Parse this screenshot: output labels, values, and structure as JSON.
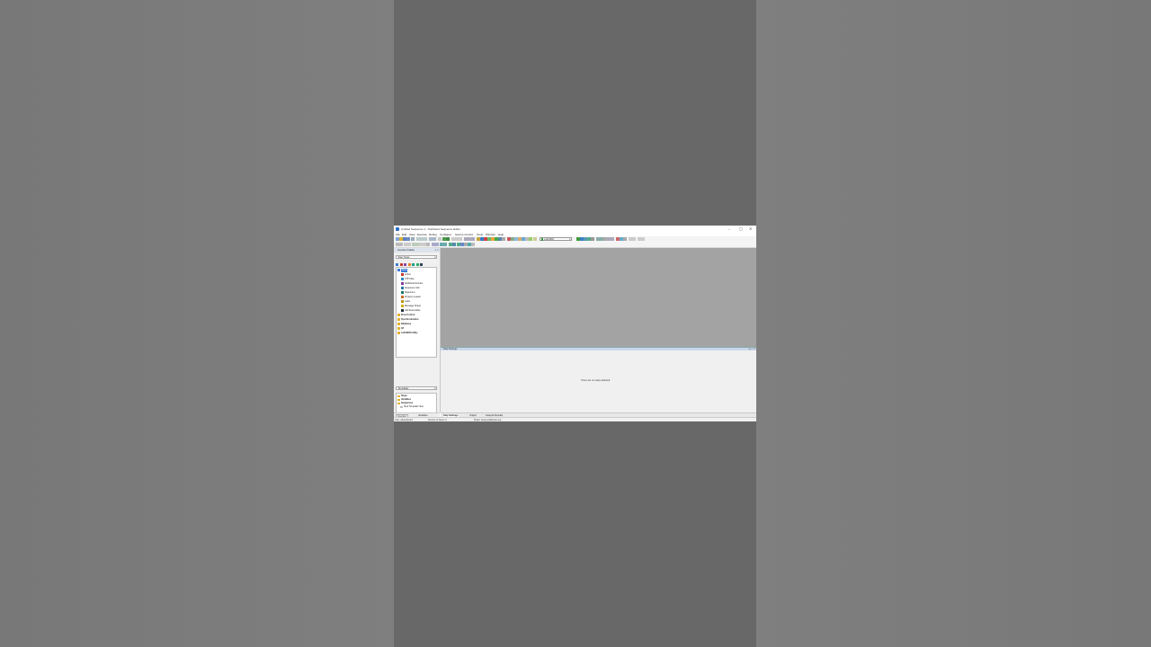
{
  "window": {
    "title": "Untitled Sequence 1 - TestStand Sequence Editor",
    "controls": [
      "–",
      "▢",
      "✕"
    ]
  },
  "menu": [
    "File",
    "Edit",
    "View",
    "Execute",
    "Debug",
    "Configure",
    "Source Control",
    "Tools",
    "Window",
    "Help"
  ],
  "toolbar": {
    "adapter_label": "LabVIEW"
  },
  "insertion_palette": {
    "title": "Insertion Palette",
    "step_types_label": "Step Types",
    "tree": [
      {
        "label": "Tests",
        "indent": 0,
        "bold": false,
        "selected": true,
        "color": "#3a7bd5"
      },
      {
        "label": "Action",
        "indent": 1,
        "bold": false,
        "selected": false,
        "color": "#c0392b"
      },
      {
        "label": "FTP Files",
        "indent": 1,
        "bold": false,
        "selected": false,
        "color": "#2e86c1"
      },
      {
        "label": "Additional Results",
        "indent": 1,
        "bold": false,
        "selected": false,
        "color": "#7d3c98"
      },
      {
        "label": "Sequence Call",
        "indent": 1,
        "bold": false,
        "selected": false,
        "color": "#2874a6"
      },
      {
        "label": "Statement",
        "indent": 1,
        "bold": false,
        "selected": false,
        "color": "#117a65"
      },
      {
        "label": "Property Loader",
        "indent": 1,
        "bold": false,
        "selected": false,
        "color": "#ca6f1e"
      },
      {
        "label": "Label",
        "indent": 1,
        "bold": false,
        "selected": false,
        "color": "#b7950b"
      },
      {
        "label": "Message Popup",
        "indent": 1,
        "bold": false,
        "selected": false,
        "color": "#d4ac0d"
      },
      {
        "label": "Call Executable",
        "indent": 1,
        "bold": false,
        "selected": false,
        "color": "#1f2d3d"
      },
      {
        "label": "Flow Control",
        "indent": 0,
        "bold": true,
        "selected": false,
        "color": "#e0b030"
      },
      {
        "label": "Synchronization",
        "indent": 0,
        "bold": true,
        "selected": false,
        "color": "#e0b030"
      },
      {
        "label": "Database",
        "indent": 0,
        "bold": true,
        "selected": false,
        "color": "#e0b030"
      },
      {
        "label": "IVI",
        "indent": 0,
        "bold": true,
        "selected": false,
        "color": "#e0b030"
      },
      {
        "label": "LabVIEW Utility",
        "indent": 0,
        "bold": true,
        "selected": false,
        "color": "#e0b030"
      }
    ],
    "templates_label": "Templates",
    "templates_tree": [
      {
        "label": "Steps",
        "bold": true,
        "indent": 0
      },
      {
        "label": "Variables",
        "bold": true,
        "indent": 0
      },
      {
        "label": "Sequences",
        "bold": true,
        "indent": 0
      },
      {
        "label": "Stop Template Here",
        "bold": false,
        "indent": 1
      }
    ]
  },
  "left_tabs": [
    "Insertion",
    "Variables"
  ],
  "step_settings": {
    "title": "Step Settings",
    "empty_message": "There are no steps selected"
  },
  "bottom_tabs": [
    "Step Settings",
    "Output",
    "Analysis Results"
  ],
  "status": {
    "user": "User: administrator",
    "model": "Model: SequentialModel.seq",
    "sequence": "Number of Steps: 0"
  }
}
